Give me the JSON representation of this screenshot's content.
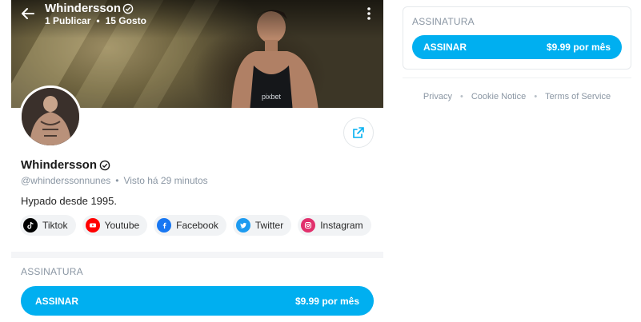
{
  "header": {
    "name": "Whindersson",
    "posts": "1 Publicar",
    "likes": "15 Gosto",
    "stats_separator": "•"
  },
  "profile": {
    "name": "Whindersson",
    "handle": "@whinderssonnunes",
    "meta_separator": "•",
    "last_seen": "Visto  há 29 minutos",
    "bio": "Hypado desde 1995."
  },
  "socials": [
    {
      "label": "Tiktok",
      "icon": "tiktok-icon",
      "color": "#000000"
    },
    {
      "label": "Youtube",
      "icon": "youtube-icon",
      "color": "#ff0000"
    },
    {
      "label": "Facebook",
      "icon": "facebook-icon",
      "color": "#1877f2"
    },
    {
      "label": "Twitter",
      "icon": "twitter-icon",
      "color": "#1d9bf0"
    },
    {
      "label": "Instagram",
      "icon": "instagram-icon",
      "color": "#e1306c"
    }
  ],
  "subscription": {
    "title": "ASSINATURA",
    "button_label": "ASSINAR",
    "price": "$9.99 por mês"
  },
  "footer": {
    "links": [
      "Privacy",
      "Cookie Notice",
      "Terms of Service"
    ],
    "separator": "•"
  },
  "colors": {
    "accent": "#00aff0",
    "muted_text": "#8a96a3"
  }
}
